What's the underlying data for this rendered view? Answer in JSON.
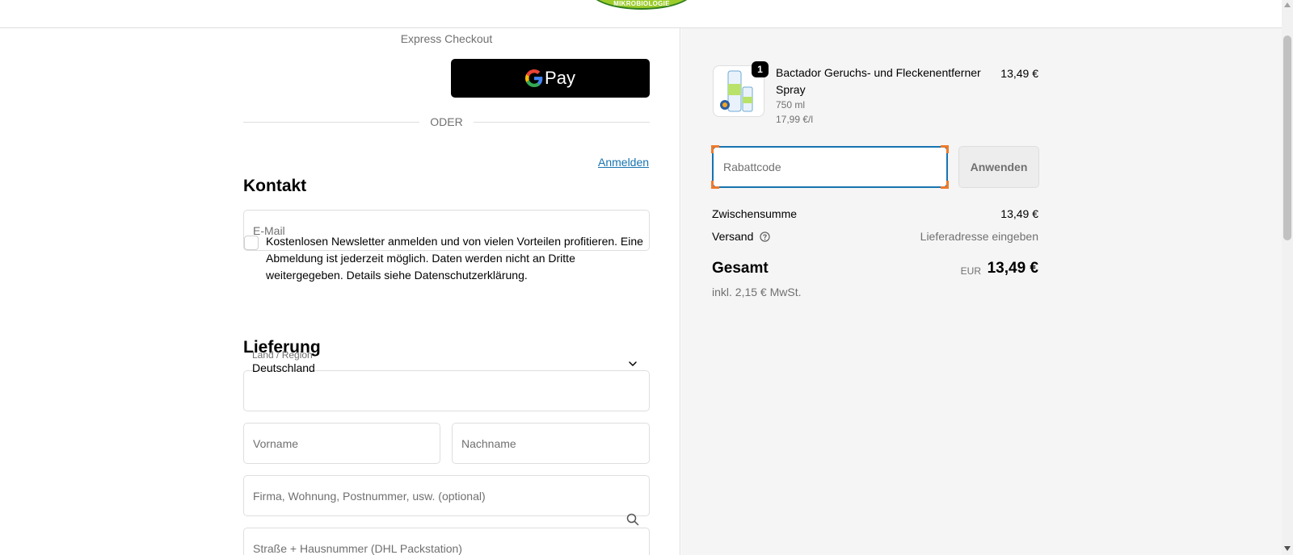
{
  "header": {
    "logo_text": "MIKROBIOLOGIE"
  },
  "express": {
    "label": "Express Checkout",
    "gpay_label": "Pay"
  },
  "divider": {
    "label": "ODER"
  },
  "contact": {
    "title": "Kontakt",
    "login_link": "Anmelden",
    "email_placeholder": "E-Mail",
    "newsletter_text": "Kostenlosen Newsletter anmelden und von vielen Vorteilen profitieren. Eine Abmeldung ist jederzeit möglich. Daten werden nicht an Dritte weitergegeben. Details siehe Datenschutzerklärung.",
    "newsletter_checked": false
  },
  "delivery": {
    "title": "Lieferung",
    "country_label": "Land / Region",
    "country_value": "Deutschland",
    "firstname_placeholder": "Vorname",
    "lastname_placeholder": "Nachname",
    "company_placeholder": "Firma, Wohnung, Postnummer, usw. (optional)",
    "street_placeholder": "Straße + Hausnummer (DHL Packstation)"
  },
  "cart": {
    "item": {
      "quantity": "1",
      "name": "Bactador Geruchs- und Fleckenentferner Spray",
      "variant": "750 ml",
      "unit_price": "17,99 €/l",
      "price": "13,49 €"
    },
    "discount_placeholder": "Rabattcode",
    "apply_label": "Anwenden",
    "subtotal_label": "Zwischensumme",
    "subtotal_value": "13,49 €",
    "shipping_label": "Versand",
    "shipping_value": "Lieferadresse eingeben",
    "total_label": "Gesamt",
    "total_currency": "EUR",
    "total_value": "13,49 €",
    "tax_note": "inkl. 2,15 € MwSt."
  },
  "colors": {
    "accent": "#1773b0",
    "focus_corner": "#f07a2a",
    "sidebar_bg": "#f5f5f5"
  },
  "icons": [
    "google-g-icon",
    "chevron-down-icon",
    "search-icon",
    "help-circle-icon"
  ]
}
